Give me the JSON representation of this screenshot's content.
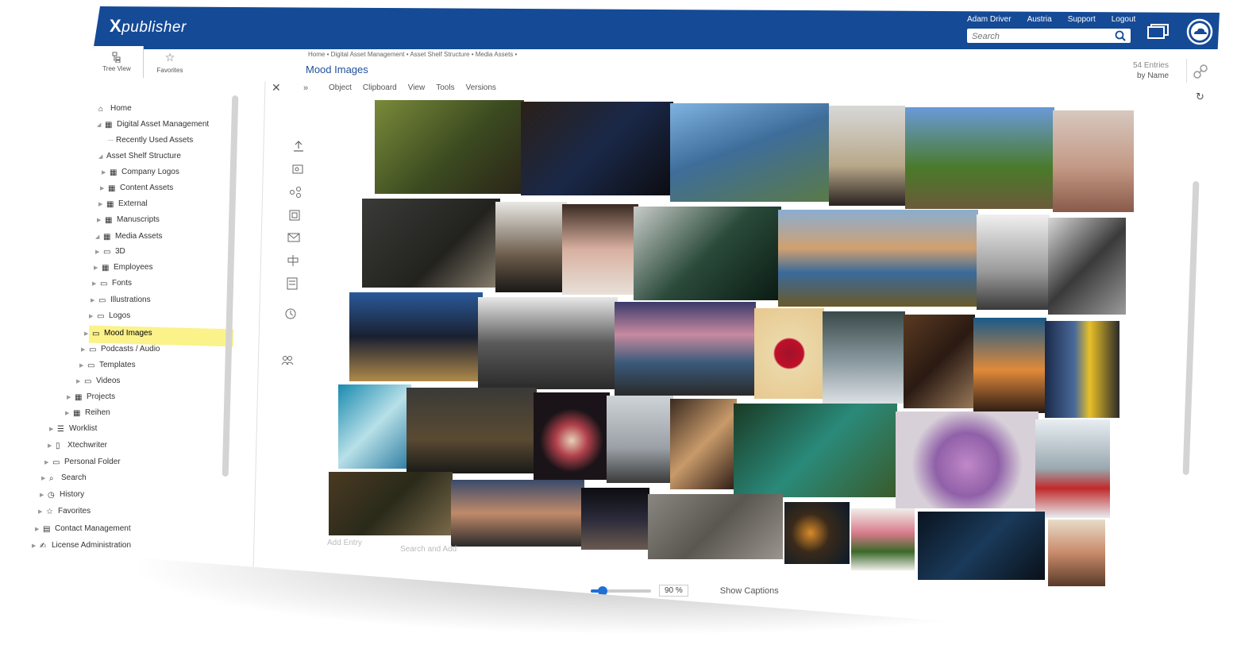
{
  "app": {
    "brand_x": "X",
    "brand_rest": "publisher"
  },
  "header": {
    "user": "Adam Driver",
    "region": "Austria",
    "support": "Support",
    "logout": "Logout",
    "search_placeholder": "Search"
  },
  "left_tabs": [
    {
      "label": "Tree View"
    },
    {
      "label": "Favorites"
    }
  ],
  "tree": {
    "items": [
      {
        "label": "Home"
      },
      {
        "label": "Digital Asset Management"
      },
      {
        "label": "Recently Used Assets"
      },
      {
        "label": "Asset Shelf Structure"
      },
      {
        "label": "Company Logos"
      },
      {
        "label": "Content Assets"
      },
      {
        "label": "External"
      },
      {
        "label": "Manuscripts"
      },
      {
        "label": "Media Assets"
      },
      {
        "label": "3D"
      },
      {
        "label": "Employees"
      },
      {
        "label": "Fonts"
      },
      {
        "label": "Illustrations"
      },
      {
        "label": "Logos"
      },
      {
        "label": "Mood Images"
      },
      {
        "label": "Podcasts / Audio"
      },
      {
        "label": "Templates"
      },
      {
        "label": "Videos"
      },
      {
        "label": "Projects"
      },
      {
        "label": "Reihen"
      },
      {
        "label": "Worklist"
      },
      {
        "label": "Xtechwriter"
      },
      {
        "label": "Personal Folder"
      },
      {
        "label": "Search"
      },
      {
        "label": "History"
      },
      {
        "label": "Favorites"
      },
      {
        "label": "Contact Management"
      },
      {
        "label": "License Administration"
      }
    ]
  },
  "main": {
    "breadcrumb": "Home  •  Digital Asset Management  •  Asset Shelf Structure  •  Media Assets  •",
    "title": "Mood Images",
    "entries_count": "54 Entries",
    "sort": "by Name",
    "menu": [
      "Object",
      "Clipboard",
      "View",
      "Tools",
      "Versions"
    ],
    "add_entry": "Add Entry",
    "search_and_add": "Search and Add"
  },
  "footer": {
    "zoom_label": "90 %",
    "zoom_fraction": 0.2,
    "show_captions": "Show Captions"
  },
  "colors": {
    "brand": "#154a96",
    "highlight": "#fbf28a",
    "accent": "#1f6fd6"
  }
}
